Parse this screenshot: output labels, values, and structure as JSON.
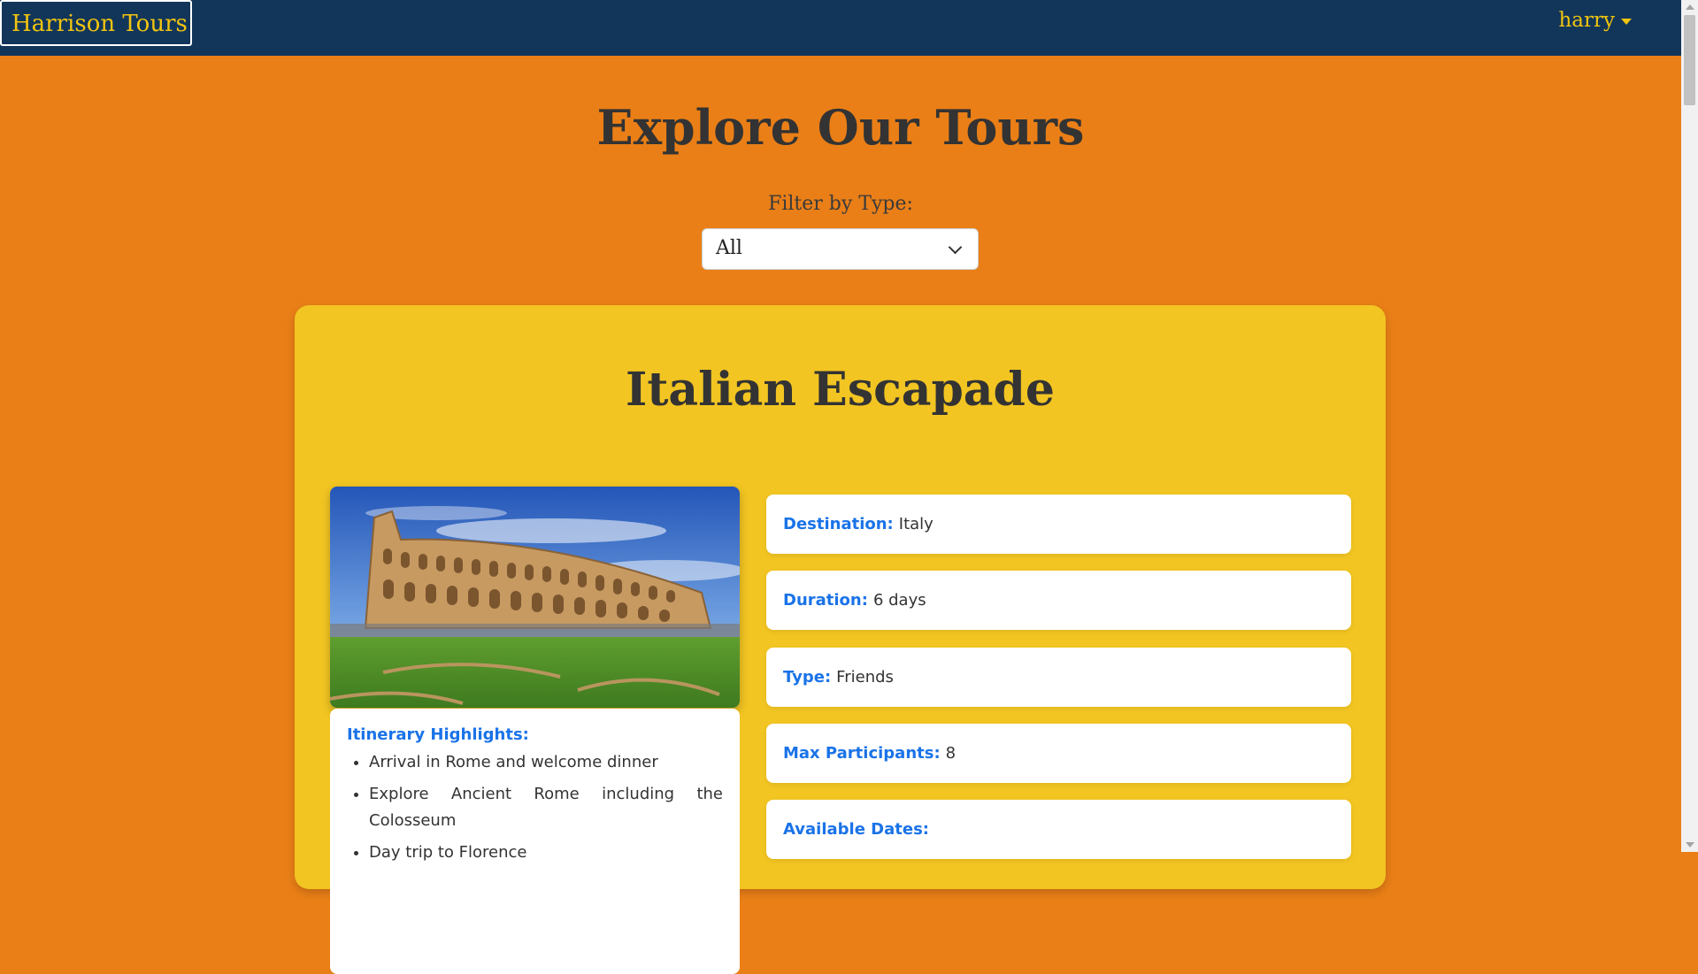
{
  "navbar": {
    "brand": "Harrison Tours",
    "user": "harry"
  },
  "page": {
    "title": "Explore Our Tours",
    "filter_label": "Filter by Type:",
    "filter_value": "All"
  },
  "tour": {
    "title": "Italian Escapade",
    "itinerary_title": "Itinerary Highlights:",
    "itinerary": [
      "Arrival in Rome and welcome dinner",
      "Explore Ancient Rome including the Colosseum",
      "Day trip to Florence"
    ],
    "details": [
      {
        "label": "Destination:",
        "value": "Italy"
      },
      {
        "label": "Duration:",
        "value": "6 days"
      },
      {
        "label": "Type:",
        "value": "Friends"
      },
      {
        "label": "Max Participants:",
        "value": "8"
      },
      {
        "label": "Available Dates:",
        "value": ""
      }
    ]
  },
  "colors": {
    "page_bg": "#ea7f17",
    "navbar_bg": "#12365a",
    "brand_text": "#f1c40f",
    "card_bg": "#f2c522",
    "label_blue": "#1a73e8"
  }
}
